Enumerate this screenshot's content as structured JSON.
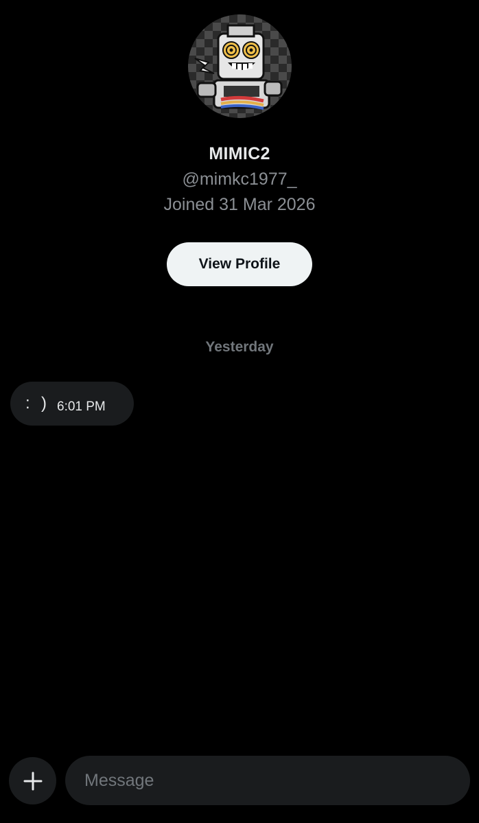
{
  "profile": {
    "avatar_icon": "robot-avatar-icon",
    "display_name": "MIMIC2",
    "handle": "@mimkc1977_",
    "joined": "Joined 31 Mar 2026",
    "view_profile_label": "View Profile"
  },
  "conversation": {
    "date_separator": "Yesterday",
    "messages": [
      {
        "text": ":  )",
        "time": "6:01 PM",
        "direction": "incoming"
      }
    ]
  },
  "composer": {
    "add_icon": "plus-icon",
    "placeholder": "Message"
  },
  "colors": {
    "background": "#000000",
    "bubble": "#1a1c1e",
    "muted_text": "#71767b",
    "button_bg": "#eff3f4"
  }
}
